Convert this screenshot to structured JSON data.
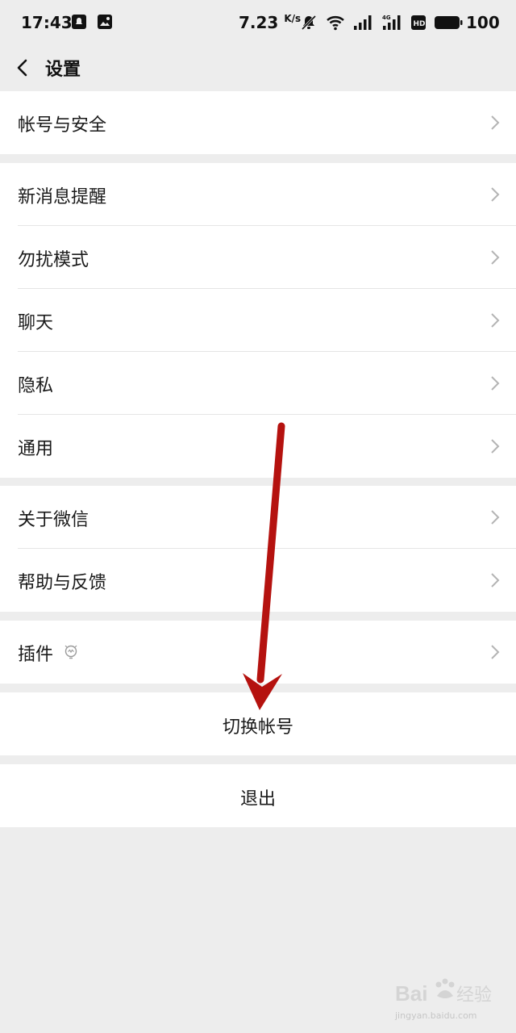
{
  "status_bar": {
    "time": "17:43",
    "speed": "7.23",
    "speed_unit": "K/s",
    "battery": "100"
  },
  "header": {
    "title": "设置"
  },
  "groups": [
    {
      "items": [
        {
          "label": "帐号与安全"
        }
      ]
    },
    {
      "items": [
        {
          "label": "新消息提醒"
        },
        {
          "label": "勿扰模式"
        },
        {
          "label": "聊天"
        },
        {
          "label": "隐私"
        },
        {
          "label": "通用"
        }
      ]
    },
    {
      "items": [
        {
          "label": "关于微信"
        },
        {
          "label": "帮助与反馈"
        }
      ]
    },
    {
      "items": [
        {
          "label": "插件"
        }
      ]
    }
  ],
  "actions": {
    "switch_account": "切换帐号",
    "logout": "退出"
  },
  "watermark": {
    "brand": "Baidu经验",
    "url": "jingyan.baidu.com"
  },
  "colors": {
    "background": "#ededed",
    "card": "#ffffff",
    "annotation_arrow": "#b5120f"
  }
}
